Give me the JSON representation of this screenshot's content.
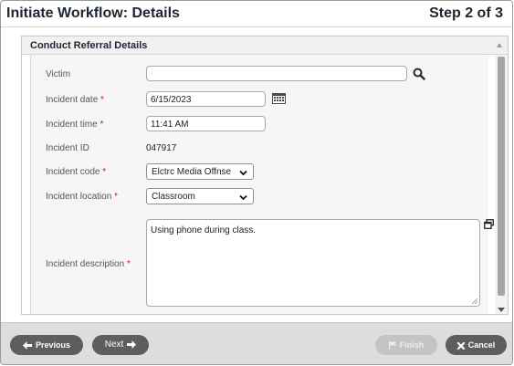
{
  "header": {
    "title": "Initiate Workflow: Details",
    "step": "Step 2 of 3"
  },
  "panel": {
    "title": "Conduct Referral Details"
  },
  "form": {
    "victim": {
      "label": "Victim",
      "value": ""
    },
    "incident_date": {
      "label": "Incident date",
      "required_mark": "*",
      "value": "6/15/2023"
    },
    "incident_time": {
      "label": "Incident time",
      "required_mark": "*",
      "value": "11:41 AM"
    },
    "incident_id": {
      "label": "Incident ID",
      "value": "047917"
    },
    "incident_code": {
      "label": "Incident code",
      "required_mark": "*",
      "value": "Elctrc Media Offnse"
    },
    "incident_location": {
      "label": "Incident location",
      "required_mark": "*",
      "value": "Classroom"
    },
    "incident_description": {
      "label": "Incident description",
      "required_mark": "*",
      "value": "Using phone during class."
    }
  },
  "footer": {
    "previous_label": "Previous",
    "next_label": "Next",
    "finish_label": "Finish",
    "cancel_label": "Cancel"
  },
  "icons": {
    "search": "search-icon",
    "calendar": "calendar-icon",
    "expand": "expand-icon",
    "previous": "arrow-left-icon",
    "next": "arrow-right-icon",
    "finish": "flag-icon",
    "cancel": "close-icon"
  },
  "colors": {
    "footer_bg": "#dddddd",
    "button_dark": "#5e5e5e",
    "button_disabled": "#c4c4c4",
    "required": "#d9141a"
  }
}
